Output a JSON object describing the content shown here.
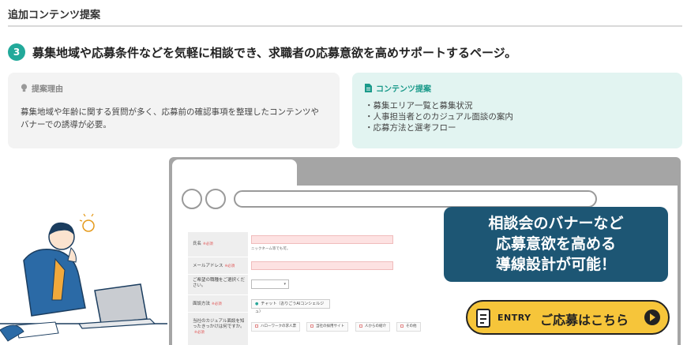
{
  "section": {
    "title": "追加コンテンツ提案"
  },
  "heading": {
    "number": "3",
    "text": "募集地域や応募条件などを気軽に相談でき、求職者の応募意欲を高めサポートするページ。"
  },
  "reason_card": {
    "title": "提案理由",
    "icon": "lightbulb-icon",
    "body": "募集地域や年齢に関する質問が多く、応募前の確認事項を整理したコンテンツやバナーでの誘導が必要。"
  },
  "content_card": {
    "title": "コンテンツ提案",
    "icon": "document-icon",
    "items": [
      "募集エリア一覧と募集状況",
      "人事担当者とのカジュアル面談の案内",
      "応募方法と選考フロー"
    ]
  },
  "form_mock": {
    "required": "※必須",
    "rows": [
      {
        "label": "氏名",
        "hint": "ニックネーム等でも可。"
      },
      {
        "label": "メールアドレス"
      },
      {
        "label": "ご希望の職種をご選択ください。",
        "select_arrow": "▾"
      },
      {
        "label": "面談方法",
        "radio": "チャット（おりごうAIコンシェルジュ）"
      },
      {
        "label": "当社のカジュアル面談を知ったきっかけは何ですか。",
        "checks": [
          "ハローワークの求人票",
          "当社の採用サイト",
          "人からの紹介",
          "その他"
        ]
      }
    ]
  },
  "callout": {
    "lines": [
      "相談会のバナーなど",
      "応募意欲を高める",
      "導線設計が可能！"
    ]
  },
  "entry_button": {
    "tag": "ENTRY",
    "label": "ご応募はこちら",
    "icon": "play-icon"
  },
  "colors": {
    "accent": "#22a99a",
    "callout": "#1d5674",
    "button": "#f6c53a"
  }
}
